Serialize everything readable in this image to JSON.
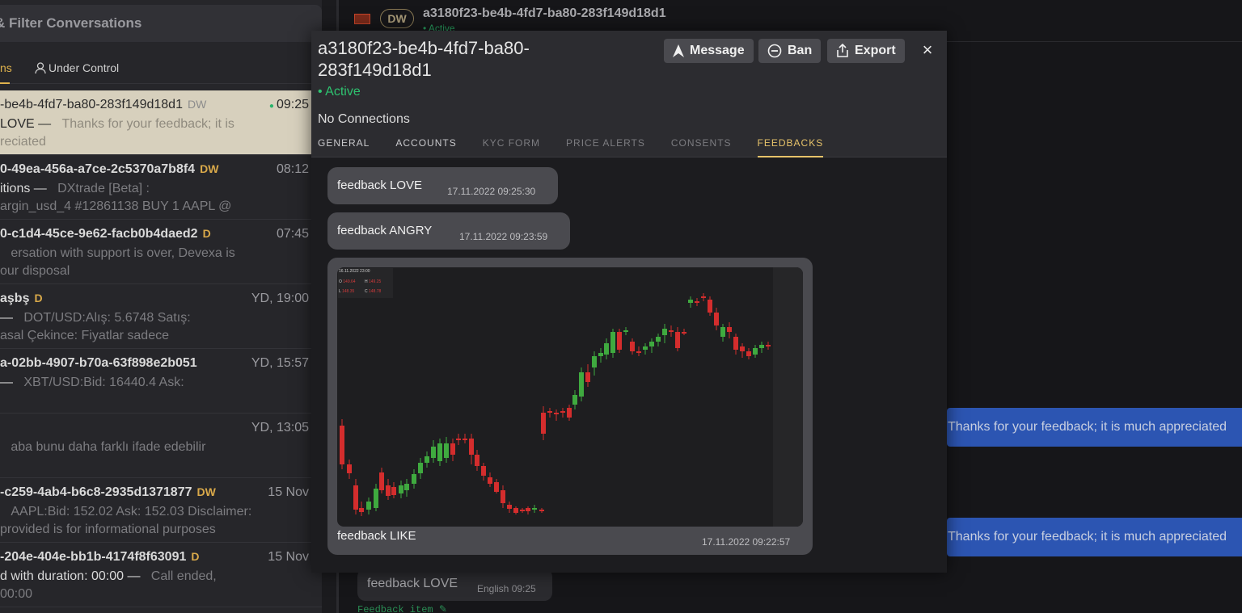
{
  "left": {
    "search_label": "& Filter Conversations",
    "tab_a": "ns",
    "tab_b": "Under Control",
    "conversations": [
      {
        "title": "-be4b-4fd7-ba80-283f149d18d1",
        "tag": "DW",
        "time": "09:25",
        "p1a": "LOVE —",
        "p1b": "Thanks for your feedback; it is",
        "p2": "reciated"
      },
      {
        "title": "0-49ea-456a-a7ce-2c5370a7b8f4",
        "tag": "DW",
        "time": "08:12",
        "p1a": "itions —",
        "p1b": "DXtrade [Beta] :",
        "p2": "argin_usd_4 #12861138 BUY 1 AAPL @"
      },
      {
        "title": "0-c1d4-45ce-9e62-facb0b4daed2",
        "tag": "D",
        "time": "07:45",
        "p1a": "",
        "p1b": "ersation with support is over, Devexa is",
        "p2": "our disposal"
      },
      {
        "title": "aşbş",
        "tag": "D",
        "time": "YD, 19:00",
        "p1a": "—",
        "p1b": "DOT/USD:Alış: 5.6748 Satış:",
        "p2": "asal Çekince: Fiyatlar sadece"
      },
      {
        "title": "a-02bb-4907-b70a-63f898e2b051",
        "tag": "",
        "time": "YD, 15:57",
        "p1a": "—",
        "p1b": "XBT/USD:Bid: 16440.4 Ask:",
        "p2": ""
      },
      {
        "title": "",
        "tag": "",
        "time": "YD, 13:05",
        "p1a": "",
        "p1b": "aba bunu daha farklı ifade edebilir",
        "p2": ""
      },
      {
        "title": "-c259-4ab4-b6c8-2935d1371877",
        "tag": "DW",
        "time": "15 Nov",
        "p1a": "",
        "p1b": "AAPL:Bid: 152.02 Ask: 152.03 Disclaimer:",
        "p2": "provided is for informational purposes"
      },
      {
        "title": "-204e-404e-bb1b-4174f8f63091",
        "tag": "D",
        "time": "15 Nov",
        "p1a": "d with duration: 00:00 —",
        "p1b": "Call ended,",
        "p2": "00:00"
      }
    ]
  },
  "chat": {
    "badge": "DW",
    "title": "a3180f23-be4b-4fd7-ba80-283f149d18d1",
    "status": "• Active",
    "blue_msg_1": "Thanks for your feedback; it is much appreciated",
    "blue_msg_2": "Thanks for your feedback; it is much appreciated",
    "bottom_feedback": "feedback LOVE",
    "bottom_meta": "English  09:25",
    "feedback_item": "Feedback item"
  },
  "modal": {
    "title": "a3180f23-be4b-4fd7-ba80-283f149d18d1",
    "active": "• Active",
    "connections": "No Connections",
    "buttons": {
      "message": "Message",
      "ban": "Ban",
      "export": "Export"
    },
    "close": "×",
    "tabs": [
      "GENERAL",
      "ACCOUNTS",
      "KYC FORM",
      "PRICE ALERTS",
      "CONSENTS",
      "FEEDBACKS"
    ],
    "active_tab": "FEEDBACKS",
    "feedbacks": [
      {
        "text": "feedback LOVE",
        "date": "17.11.2022 09:25:30"
      },
      {
        "text": "feedback ANGRY",
        "date": "17.11.2022 09:23:59"
      },
      {
        "text": "feedback LIKE",
        "date": "17.11.2022 09:22:57"
      }
    ],
    "chart_ohlc": {
      "header": "16.11.2022 23:00",
      "o": "149.64",
      "h": "149.25",
      "l": "148.35",
      "c": "148.78"
    }
  },
  "colors": {
    "accent": "#e7c36a",
    "active": "#2ec26f",
    "up": "#3faa3f",
    "down": "#d42d2d",
    "blue": "#2c55b2"
  }
}
